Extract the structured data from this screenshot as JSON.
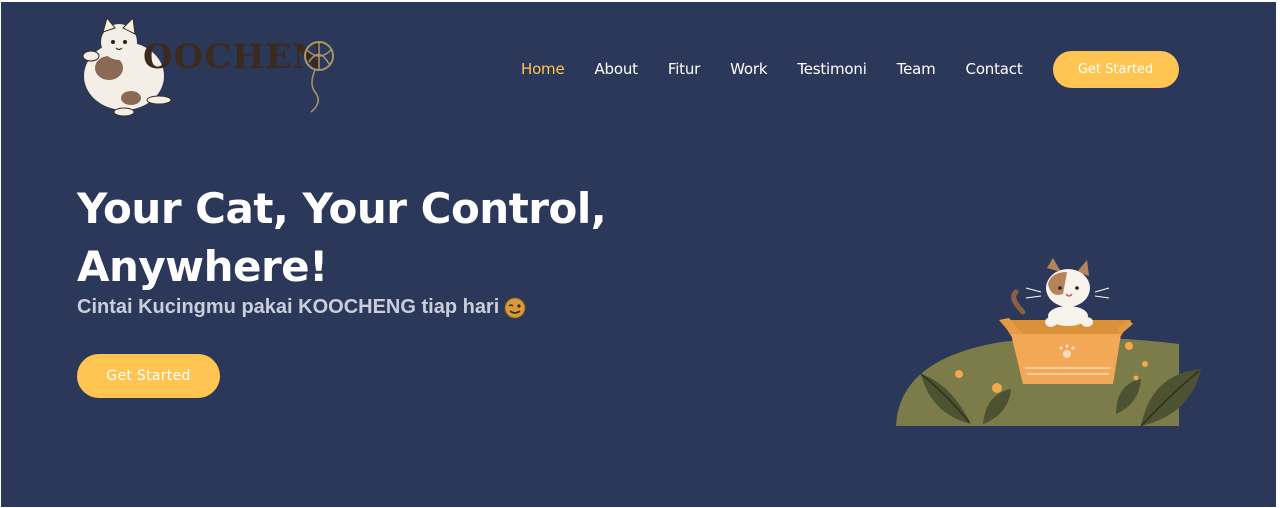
{
  "brand": {
    "logo_text": "KOOCHENG"
  },
  "nav": {
    "items": [
      {
        "label": "Home",
        "active": true
      },
      {
        "label": "About",
        "active": false
      },
      {
        "label": "Fitur",
        "active": false
      },
      {
        "label": "Work",
        "active": false
      },
      {
        "label": "Testimoni",
        "active": false
      },
      {
        "label": "Team",
        "active": false
      },
      {
        "label": "Contact",
        "active": false
      }
    ],
    "cta_label": "Get Started"
  },
  "hero": {
    "title_line1": "Your Cat, Your Control,",
    "title_line2": "Anywhere!",
    "subtitle": "Cintai Kucingmu pakai KOOCHENG tiap hari",
    "emoji_icon": "winking-face-icon",
    "cta_label": "Get Started",
    "illustration_icon": "cat-in-box-illustration"
  },
  "colors": {
    "background": "#2c3859",
    "accent": "#ffc451",
    "text": "#ffffff",
    "subtitle": "#c9cedb",
    "grass": "#7c7c4a"
  }
}
